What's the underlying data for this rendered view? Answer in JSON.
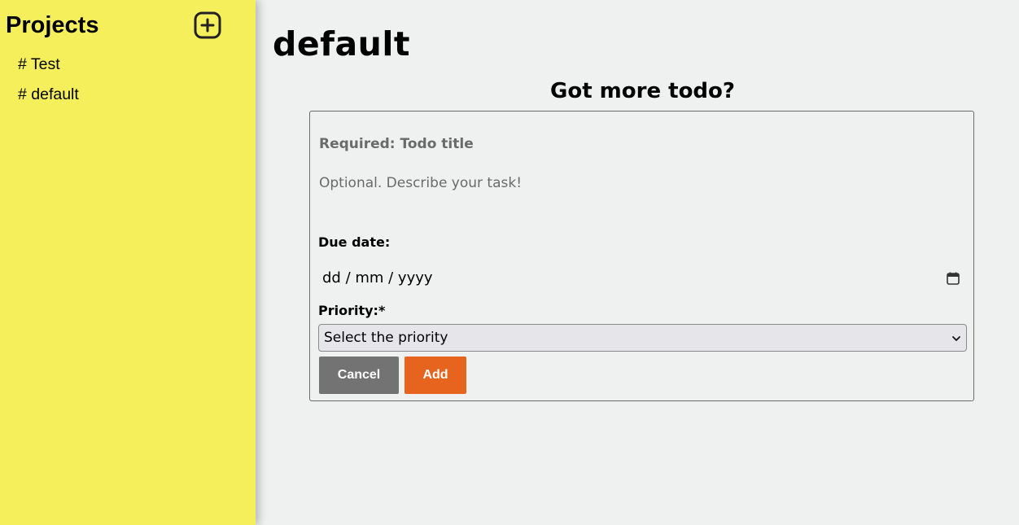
{
  "sidebar": {
    "title": "Projects",
    "add_button_icon": "plus-square-icon",
    "projects": [
      {
        "label": "# Test"
      },
      {
        "label": "# default"
      }
    ]
  },
  "main": {
    "page_title": "default",
    "form": {
      "heading": "Got more todo?",
      "title_placeholder": "Required: Todo title",
      "description_placeholder": "Optional. Describe your task!",
      "due_label": "Due date:",
      "date_placeholder": "dd / mm / yyyy",
      "date_icon": "calendar-icon",
      "priority_label": "Priority:*",
      "priority_selected": "Select the priority",
      "cancel_label": "Cancel",
      "add_label": "Add"
    }
  },
  "colors": {
    "sidebar_bg": "#f5ef5c",
    "main_bg": "#eff1f0",
    "cancel_bg": "#737373",
    "add_bg": "#e7641f"
  }
}
